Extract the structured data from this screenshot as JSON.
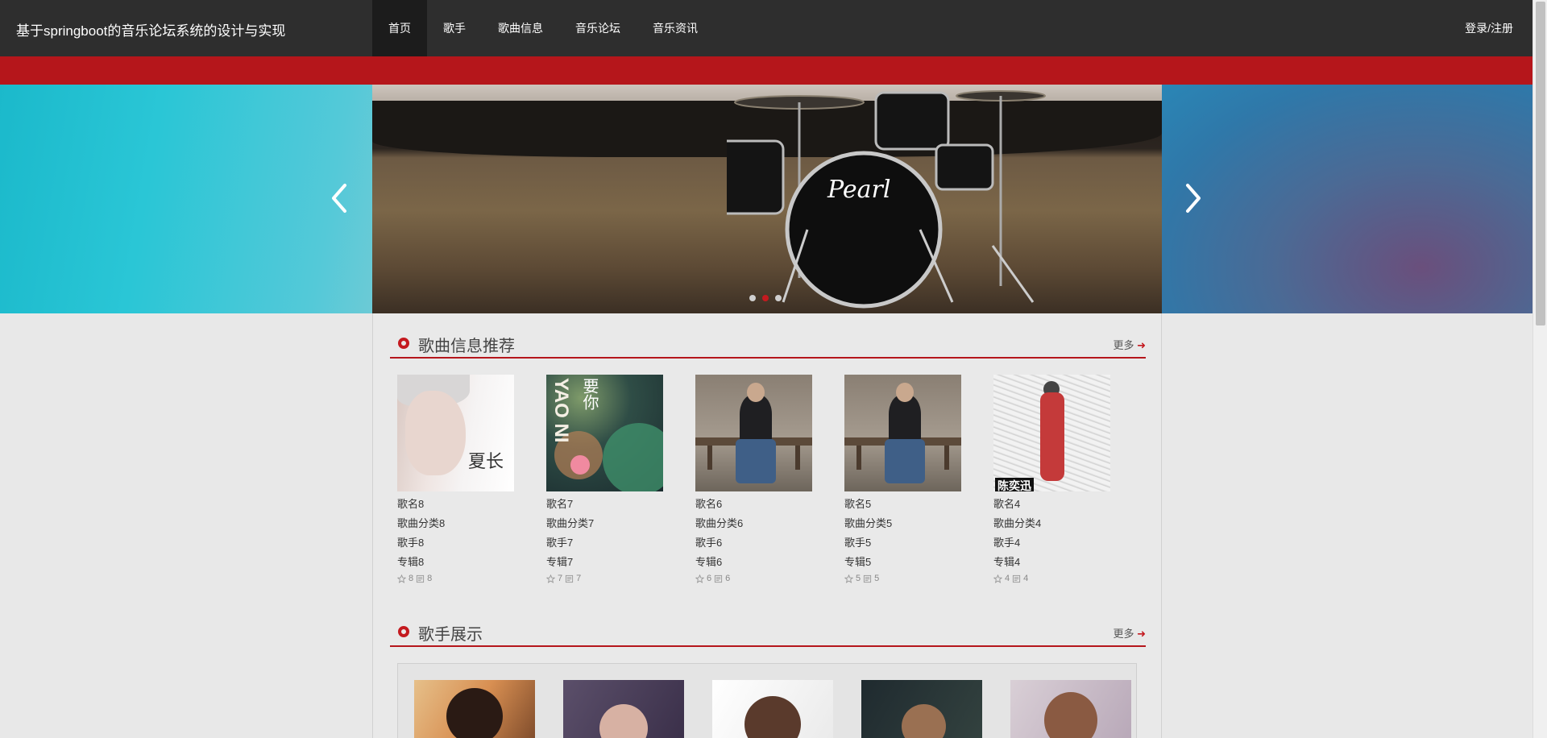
{
  "site": {
    "title": "基于springboot的音乐论坛系统的设计与实现"
  },
  "nav": {
    "items": [
      "首页",
      "歌手",
      "歌曲信息",
      "音乐论坛",
      "音乐资讯"
    ],
    "active_index": 0,
    "login": "登录/注册"
  },
  "banner": {
    "drum_brand": "Pearl",
    "slide_count": 3,
    "active_slide": 1
  },
  "song_section": {
    "title": "歌曲信息推荐",
    "more": "更多",
    "songs": [
      {
        "name": "歌名8",
        "category": "歌曲分类8",
        "singer": "歌手8",
        "album": "专辑8",
        "likes": "8",
        "comments": "8",
        "cover_text": "夏长"
      },
      {
        "name": "歌名7",
        "category": "歌曲分类7",
        "singer": "歌手7",
        "album": "专辑7",
        "likes": "7",
        "comments": "7",
        "cover_text": "YAO NI",
        "cover_text2": "要你"
      },
      {
        "name": "歌名6",
        "category": "歌曲分类6",
        "singer": "歌手6",
        "album": "专辑6",
        "likes": "6",
        "comments": "6"
      },
      {
        "name": "歌名5",
        "category": "歌曲分类5",
        "singer": "歌手5",
        "album": "专辑5",
        "likes": "5",
        "comments": "5"
      },
      {
        "name": "歌名4",
        "category": "歌曲分类4",
        "singer": "歌手4",
        "album": "专辑4",
        "likes": "4",
        "comments": "4",
        "cover_text": "陈奕迅"
      }
    ]
  },
  "singer_section": {
    "title": "歌手展示",
    "more": "更多"
  },
  "colors": {
    "accent": "#b5161b",
    "topbar": "#2e2e2e"
  }
}
